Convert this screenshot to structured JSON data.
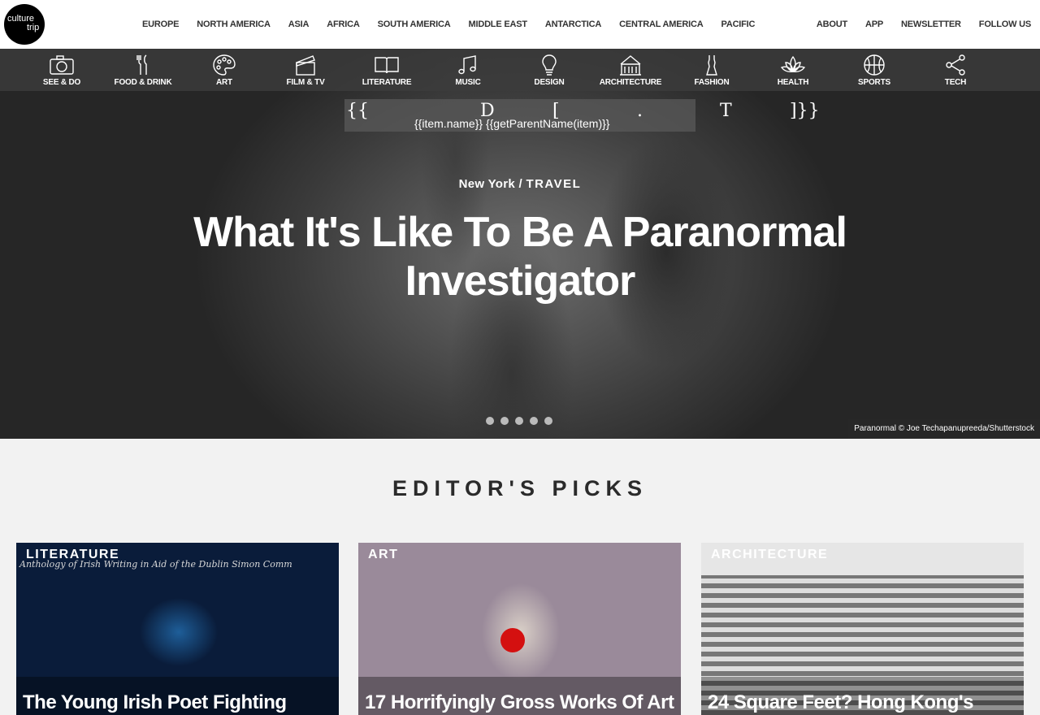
{
  "logo": {
    "line1": "culture",
    "line2": "trip"
  },
  "regions": [
    "EUROPE",
    "NORTH AMERICA",
    "ASIA",
    "AFRICA",
    "SOUTH AMERICA",
    "MIDDLE EAST",
    "ANTARCTICA",
    "CENTRAL AMERICA",
    "PACIFIC"
  ],
  "right_nav": [
    "ABOUT",
    "APP",
    "NEWSLETTER",
    "FOLLOW US"
  ],
  "categories": [
    {
      "label": "SEE & DO",
      "icon": "camera-icon"
    },
    {
      "label": "FOOD & DRINK",
      "icon": "fork-knife-icon"
    },
    {
      "label": "ART",
      "icon": "palette-icon"
    },
    {
      "label": "FILM & TV",
      "icon": "clapperboard-icon"
    },
    {
      "label": "LITERATURE",
      "icon": "book-icon"
    },
    {
      "label": "MUSIC",
      "icon": "music-note-icon"
    },
    {
      "label": "DESIGN",
      "icon": "lightbulb-icon"
    },
    {
      "label": "ARCHITECTURE",
      "icon": "building-icon"
    },
    {
      "label": "FASHION",
      "icon": "dress-icon"
    },
    {
      "label": "HEALTH",
      "icon": "lotus-icon"
    },
    {
      "label": "SPORTS",
      "icon": "basketball-icon"
    },
    {
      "label": "TECH",
      "icon": "share-icon"
    }
  ],
  "search_template": {
    "glyphs": [
      "{{",
      "D",
      "[",
      ".",
      "T",
      "]}}"
    ],
    "text": "{{item.name}} {{getParentName(item)}}"
  },
  "hero": {
    "location": "New York",
    "separator": " / ",
    "section": "TRAVEL",
    "title": "What It's Like To Be A Paranormal Investigator",
    "slide_count": 5,
    "credit": "Paranormal © Joe Techapanupreeda/Shutterstock"
  },
  "picks": {
    "heading": "EDITOR'S PICKS",
    "cards": [
      {
        "tag": "LITERATURE",
        "title": "The Young Irish Poet Fighting",
        "book_strip": "Anthology of Irish Writing in Aid of the Dublin Simon Comm"
      },
      {
        "tag": "ART",
        "title": "17 Horrifyingly Gross Works Of Art"
      },
      {
        "tag": "ARCHITECTURE",
        "title": "24 Square Feet? Hong Kong's"
      }
    ]
  },
  "colors": {
    "topbar_bg": "#ffffff",
    "page_bg": "#f2f2f2",
    "text_dark": "#333333",
    "hero_overlay": "#3c3c3c"
  }
}
